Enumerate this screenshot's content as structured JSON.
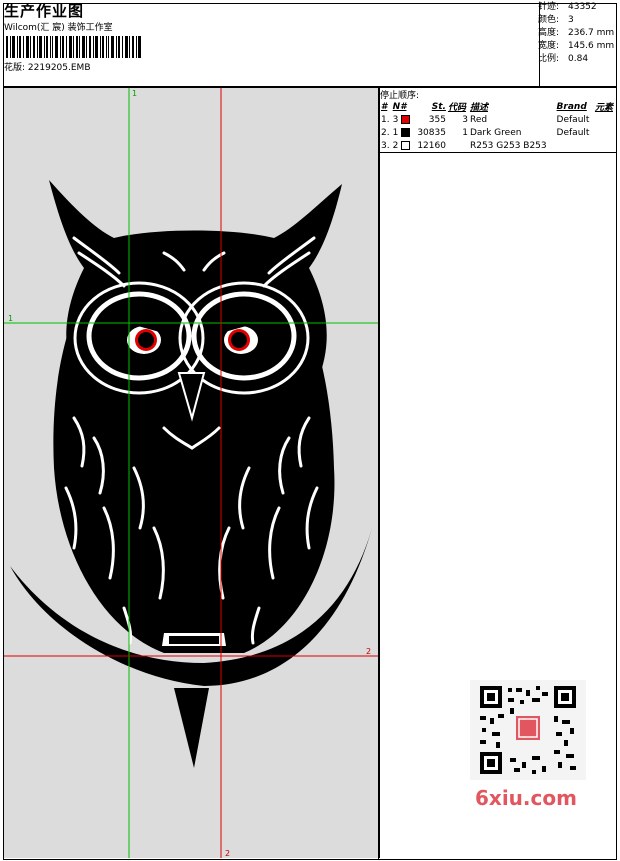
{
  "header": {
    "title": "生产作业图",
    "company": "Wilcom(汇 宸) 装饰工作室",
    "design_label": "花版:",
    "design_file": "2219205.EMB"
  },
  "stats": {
    "stitches_label": "针迹:",
    "stitches": "43352",
    "colors_label": "颜色:",
    "colors": "3",
    "height_label": "高度:",
    "height": "236.7 mm",
    "width_label": "宽度:",
    "width": "145.6 mm",
    "scale_label": "比例:",
    "scale": "0.84"
  },
  "stop_sequence": {
    "title": "停止顺序:",
    "headers": [
      "#",
      "N#",
      "St.",
      "代码",
      "描述",
      "Brand",
      "元素"
    ],
    "rows": [
      {
        "num": "1.",
        "n": "3",
        "color": "#e00000",
        "st": "355",
        "code": "3",
        "desc": "Red",
        "brand": "Default"
      },
      {
        "num": "2.",
        "n": "1",
        "color": "#000000",
        "st": "30835",
        "code": "1",
        "desc": "Dark Green",
        "brand": "Default"
      },
      {
        "num": "3.",
        "n": "2",
        "color": "#fdfdfd",
        "st": "12160",
        "code": "",
        "desc": "R253 G253 B253",
        "brand": ""
      }
    ]
  },
  "guides": {
    "green_top_label": "1",
    "green_left_label": "1",
    "red_right_label": "2",
    "red_bottom_label": "2"
  },
  "watermark": {
    "text": "6xiu.com"
  },
  "colors": {
    "canvas_bg": "#dcdcdc",
    "guide_green": "#00c000",
    "guide_red": "#e00000",
    "brand": "#e2575f"
  }
}
